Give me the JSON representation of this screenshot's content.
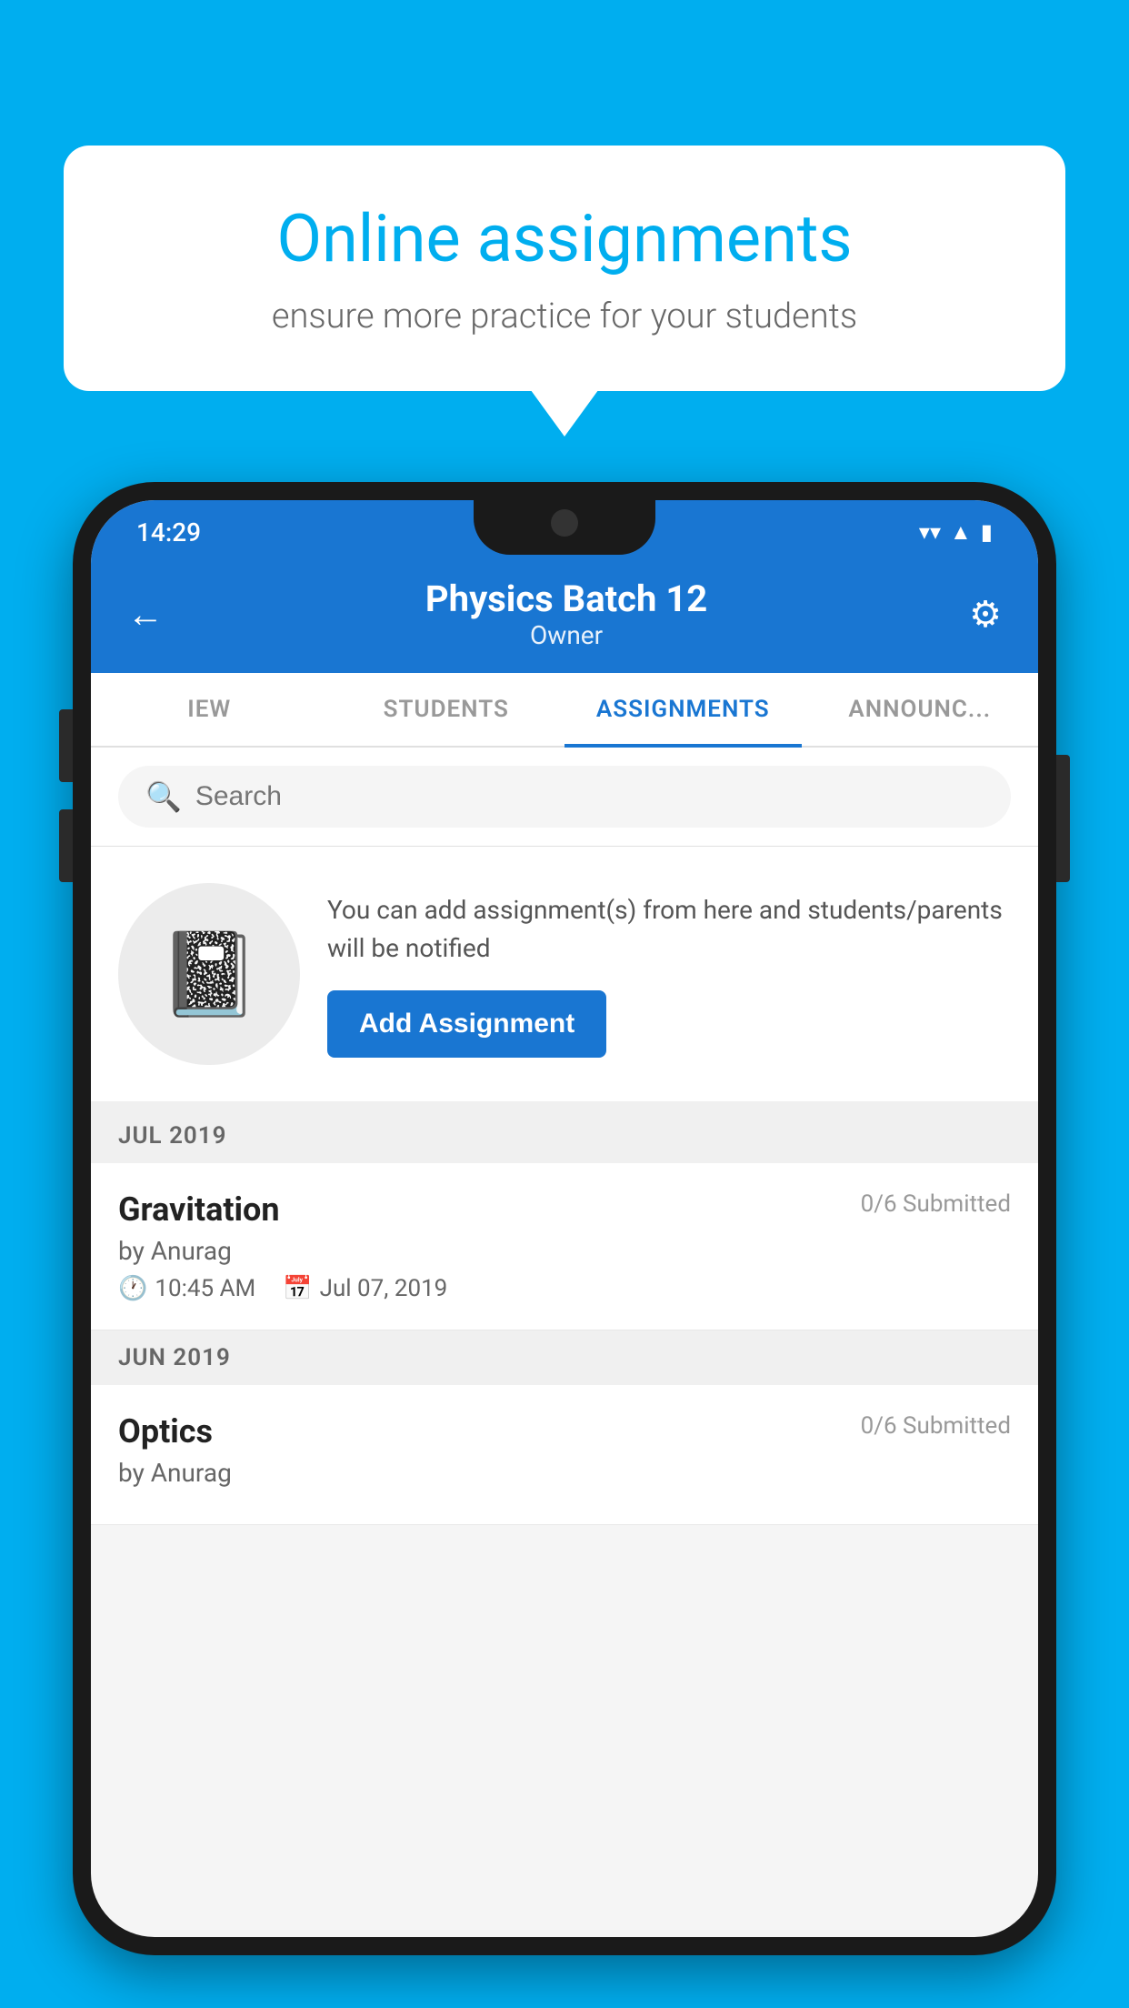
{
  "background_color": "#00AEEF",
  "speech_bubble": {
    "title": "Online assignments",
    "subtitle": "ensure more practice for your students"
  },
  "status_bar": {
    "time": "14:29",
    "icons": [
      "wifi",
      "signal",
      "battery"
    ]
  },
  "header": {
    "title": "Physics Batch 12",
    "subtitle": "Owner",
    "back_label": "←",
    "settings_label": "⚙"
  },
  "tabs": [
    {
      "label": "IEW",
      "active": false
    },
    {
      "label": "STUDENTS",
      "active": false
    },
    {
      "label": "ASSIGNMENTS",
      "active": true
    },
    {
      "label": "ANNOUNCEMENTS",
      "active": false
    }
  ],
  "search": {
    "placeholder": "Search"
  },
  "promo": {
    "text": "You can add assignment(s) from here and students/parents will be notified",
    "button_label": "Add Assignment"
  },
  "sections": [
    {
      "month_label": "JUL 2019",
      "assignments": [
        {
          "name": "Gravitation",
          "submitted": "0/6 Submitted",
          "by": "by Anurag",
          "time": "10:45 AM",
          "date": "Jul 07, 2019"
        }
      ]
    },
    {
      "month_label": "JUN 2019",
      "assignments": [
        {
          "name": "Optics",
          "submitted": "0/6 Submitted",
          "by": "by Anurag",
          "time": "",
          "date": ""
        }
      ]
    }
  ]
}
